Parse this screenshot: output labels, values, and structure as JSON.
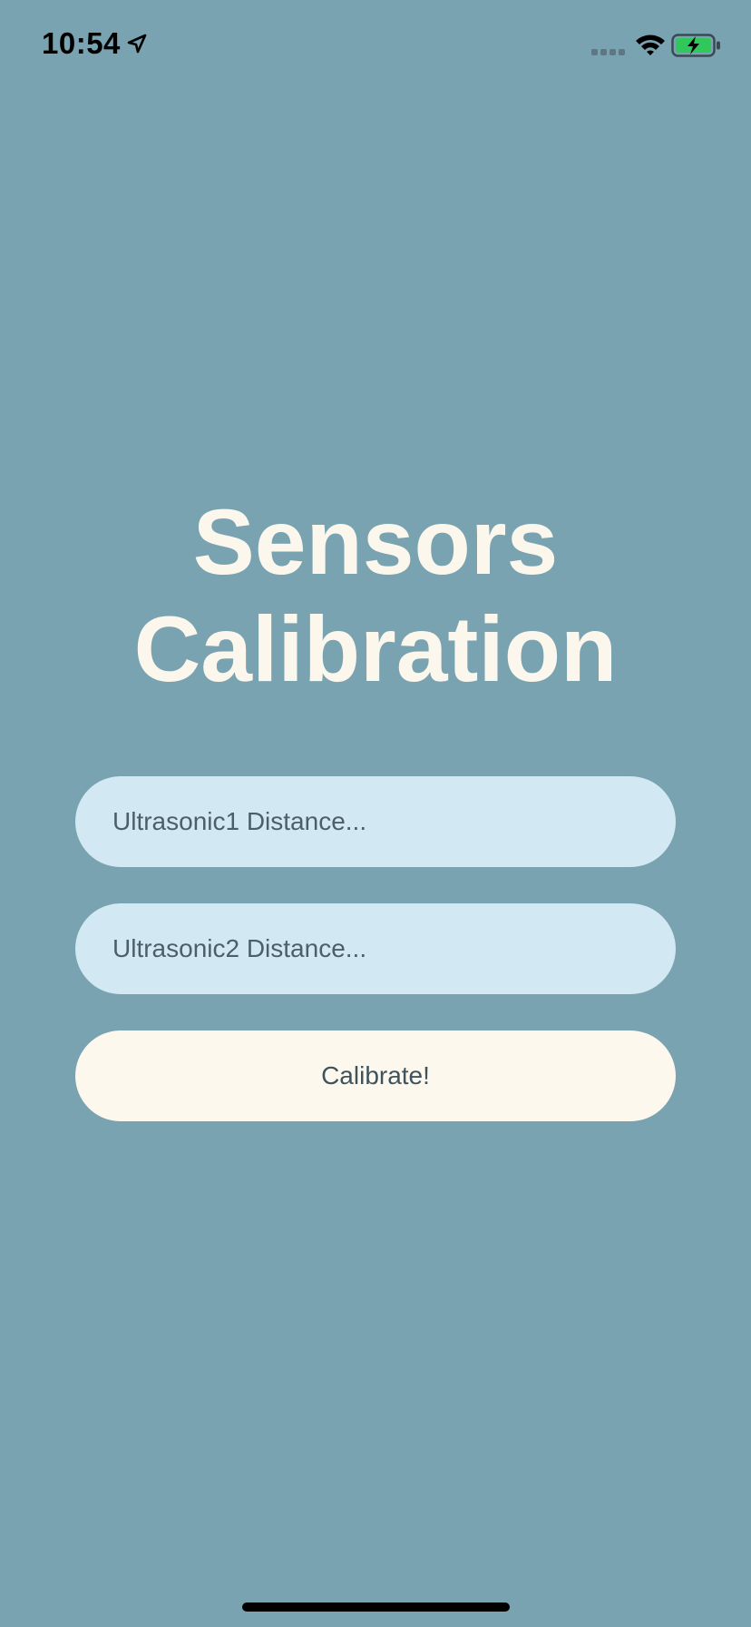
{
  "colors": {
    "background": "#7aa3b1",
    "title": "#fcf7ec",
    "input_bg": "#d2e8f2",
    "input_text": "#4a5f6a",
    "button_bg": "#fdf8ee",
    "button_text": "#3f535c",
    "status_text": "#000000",
    "battery_fill": "#30c85a",
    "home_indicator": "#000000"
  },
  "status_bar": {
    "time": "10:54",
    "icons": [
      "location-arrow-icon",
      "cellular-signal-icon",
      "wifi-icon",
      "battery-charging-icon"
    ]
  },
  "title": {
    "line1": "Sensors",
    "line2": "Calibration"
  },
  "form": {
    "ultrasonic1": {
      "placeholder": "Ultrasonic1 Distance...",
      "value": ""
    },
    "ultrasonic2": {
      "placeholder": "Ultrasonic2 Distance...",
      "value": ""
    },
    "calibrate_label": "Calibrate!"
  }
}
